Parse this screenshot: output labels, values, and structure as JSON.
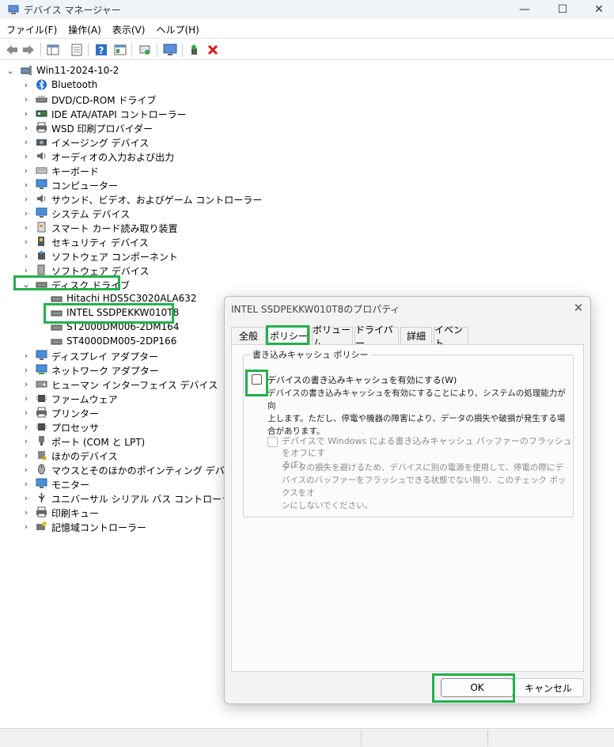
{
  "window": {
    "title": "デバイス マネージャー",
    "min": "—",
    "max": "☐",
    "close": "✕"
  },
  "menubar": [
    "ファイル(F)",
    "操作(A)",
    "表示(V)",
    "ヘルプ(H)"
  ],
  "tree": {
    "root": "Win11-2024-10-2",
    "categories": [
      {
        "label": "Bluetooth",
        "icon": "bluetooth-icon"
      },
      {
        "label": "DVD/CD-ROM ドライブ",
        "icon": "dvd-drive-icon"
      },
      {
        "label": "IDE ATA/ATAPI コントローラー",
        "icon": "ide-controller-icon"
      },
      {
        "label": "WSD 印刷プロバイダー",
        "icon": "printer-icon"
      },
      {
        "label": "イメージング デバイス",
        "icon": "camera-icon"
      },
      {
        "label": "オーディオの入力および出力",
        "icon": "speaker-icon"
      },
      {
        "label": "キーボード",
        "icon": "keyboard-icon"
      },
      {
        "label": "コンピューター",
        "icon": "monitor-icon"
      },
      {
        "label": "サウンド、ビデオ、およびゲーム コントローラー",
        "icon": "speaker-icon"
      },
      {
        "label": "システム デバイス",
        "icon": "monitor-icon"
      },
      {
        "label": "スマート カード読み取り装置",
        "icon": "smartcard-icon"
      },
      {
        "label": "セキュリティ デバイス",
        "icon": "security-icon"
      },
      {
        "label": "ソフトウェア コンポーネント",
        "icon": "puzzle-icon"
      },
      {
        "label": "ソフトウェア デバイス",
        "icon": "software-device-icon"
      }
    ],
    "disk_drives": {
      "label": "ディスク ドライブ",
      "children": [
        "Hitachi HDS5C3020ALA632",
        "INTEL SSDPEKKW010T8",
        "ST2000DM006-2DM164",
        "ST4000DM005-2DP166"
      ]
    },
    "categories_after": [
      {
        "label": "ディスプレイ アダプター",
        "icon": "monitor-icon"
      },
      {
        "label": "ネットワーク アダプター",
        "icon": "network-icon"
      },
      {
        "label": "ヒューマン インターフェイス デバイス",
        "icon": "hid-icon"
      },
      {
        "label": "ファームウェア",
        "icon": "chip-icon"
      },
      {
        "label": "プリンター",
        "icon": "printer-icon"
      },
      {
        "label": "プロセッサ",
        "icon": "chip-icon"
      },
      {
        "label": "ポート (COM と LPT)",
        "icon": "port-icon"
      },
      {
        "label": "ほかのデバイス",
        "icon": "unknown-device-icon"
      },
      {
        "label": "マウスとそのほかのポインティング デバイス",
        "icon": "mouse-icon"
      },
      {
        "label": "モニター",
        "icon": "monitor-icon"
      },
      {
        "label": "ユニバーサル シリアル バス コントローラー",
        "icon": "usb-icon"
      },
      {
        "label": "印刷キュー",
        "icon": "printer-icon"
      },
      {
        "label": "記憶域コントローラー",
        "icon": "storage-controller-icon"
      }
    ]
  },
  "dialog": {
    "title": "INTEL SSDPEKKW010T8のプロパティ",
    "tabs": [
      "全般",
      "ポリシー",
      "ボリューム",
      "ドライバー",
      "詳細",
      "イベント"
    ],
    "active_tab": "ポリシー",
    "group_title": "書き込みキャッシュ ポリシー",
    "option1": {
      "label": "デバイスの書き込みキャッシュを有効にする(W)",
      "checked": false,
      "desc": [
        "デバイスの書き込みキャッシュを有効にすることにより、システムの処理能力が向",
        "上します。ただし、停電や機器の障害により、データの損失や破損が発生する場",
        "合があります。"
      ]
    },
    "option2": {
      "label1": "デバイスで Windows による書き込みキャッシュ バッファーのフラッシュをオフにす",
      "label2": "る(F)",
      "checked": false,
      "disabled": true,
      "desc": [
        "データの損失を避けるため、デバイスに別の電源を使用して、停電の際にデ",
        "バイスのバッファーをフラッシュできる状態でない限り、このチェック ボックスをオ",
        "ンにしないでください。"
      ]
    },
    "ok": "OK",
    "cancel": "キャンセル"
  },
  "colors": {
    "highlight": "#22b14c",
    "titlebar": "#eff4f9"
  }
}
